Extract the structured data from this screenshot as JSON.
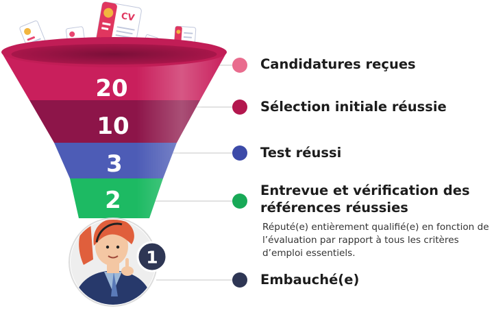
{
  "stages": [
    {
      "label": "Candidatures reçues",
      "count": "20",
      "color": "#e96c8e"
    },
    {
      "label": "Sélection initiale réussie",
      "count": "10",
      "color": "#b3174e"
    },
    {
      "label": "Test réussi",
      "count": "3",
      "color": "#3c4aa8"
    },
    {
      "label": "Entrevue et vérification des références réussies",
      "count": "2",
      "color": "#18a957"
    },
    {
      "label": "Embauché(e)",
      "count": "1",
      "color": "#2e3654"
    }
  ],
  "hire_note": "Réputé(e) entièrement qualifié(e) en fonction de l’évaluation par rapport à tous les critères d’emploi essentiels.",
  "resume_badge": "CV",
  "colors": {
    "funnel_rim": "#c11d56",
    "band_20": "#c91f5c",
    "band_10": "#8d1549",
    "band_3": "#4d5cb6",
    "band_2": "#1dba63",
    "badge": "#2e3654"
  },
  "icons": [
    "resume-icon",
    "person-illustration"
  ]
}
